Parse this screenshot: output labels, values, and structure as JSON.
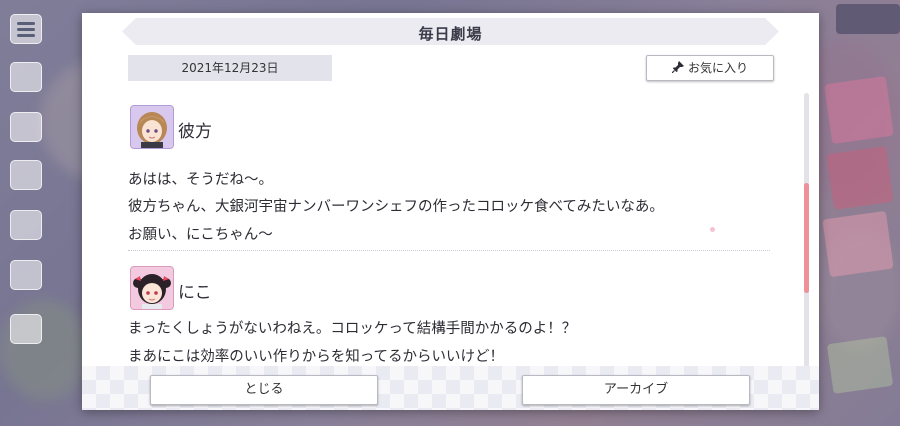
{
  "theater": {
    "title": "毎日劇場",
    "date": "2021年12月23日",
    "favorite_label": "お気に入り"
  },
  "entries": [
    {
      "speaker": "彼方",
      "avatar_icon": "kanata-avatar-icon",
      "lines": [
        "あはは、そうだね〜。",
        "彼方ちゃん、大銀河宇宙ナンバーワンシェフの作ったコロッケ食べてみたいなあ。",
        "お願い、にこちゃん〜"
      ]
    },
    {
      "speaker": "にこ",
      "avatar_icon": "nico-avatar-icon",
      "lines": [
        "まったくしょうがないわねえ。コロッケって結構手間かかるのよ！？",
        "まあにこは効率のいい作りからを知ってるからいいけど！"
      ]
    }
  ],
  "buttons": {
    "close_label": "とじる",
    "archive_label": "アーカイブ"
  },
  "scroll": {
    "position_fraction": 0.55
  },
  "colors": {
    "scrollbar_accent": "#ee8f9a",
    "title_bar": "#ebebf1",
    "date_box": "#e3e3ec"
  }
}
